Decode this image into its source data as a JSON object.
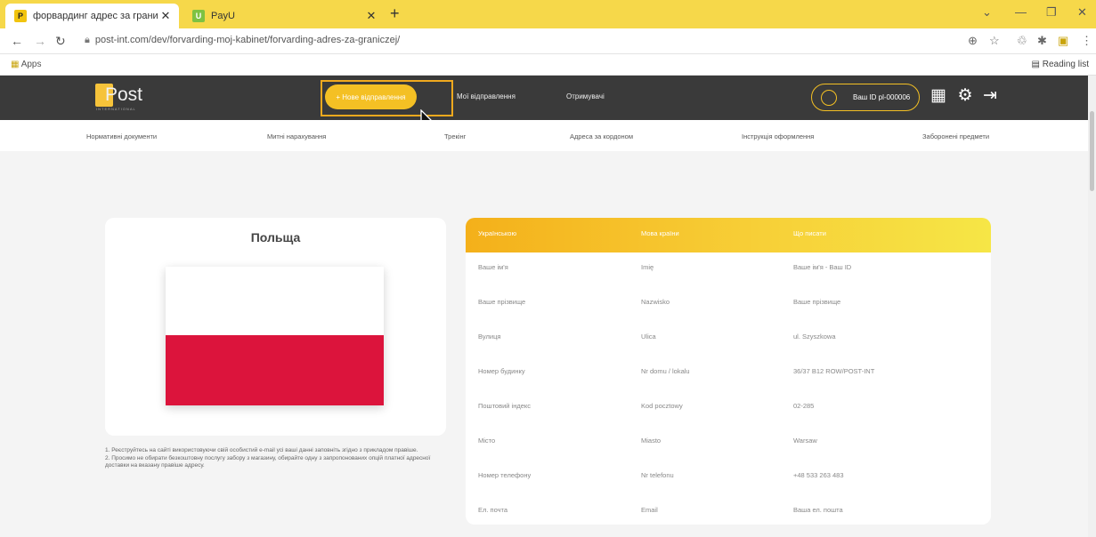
{
  "browser": {
    "tabs": [
      {
        "title": "форвардинг адрес за границей",
        "favicon": "P",
        "active": true
      },
      {
        "title": "PayU",
        "favicon": "U",
        "active": false
      }
    ],
    "url": "post-int.com/dev/forvarding-moj-kabinet/forvarding-adres-za-graniczej/",
    "bookmarks_apps": "Apps",
    "reading_list": "Reading list"
  },
  "site": {
    "logo": {
      "word": "Post",
      "tagline": "INTERNATIONAL"
    },
    "header": {
      "new_shipment": "+ Нове відправлення",
      "my_shipments": "Мої відправлення",
      "recipients": "Отримувачі",
      "account_label": "Ваш ID pl-000006"
    },
    "subnav": [
      "Нормативні документи",
      "Митні нарахування",
      "Трекінг",
      "Адреса за кордоном",
      "Інструкція оформлення",
      "Заборонені предмети"
    ]
  },
  "country": {
    "name": "Польща",
    "flag_colors": {
      "top": "#ffffff",
      "bottom": "#dc143c"
    }
  },
  "notes": [
    "1. Реєструйтесь на сайті використовуючи свій особистий e-mail усі ваші данні заповніть згідно з прикладом правіше.",
    "2. Просимо не обирати безкоштовну послугу забору з магазину, обирайте одну з запропонованих опцій платної адресної доставки на вказану правіше адресу."
  ],
  "address_table": {
    "headers": [
      "Українською",
      "Мова країни",
      "Що писати"
    ],
    "rows": [
      [
        "Ваше ім'я",
        "Imię",
        "Ваше ім'я - Ваш ID"
      ],
      [
        "Ваше прізвище",
        "Nazwisko",
        "Ваше прізвище"
      ],
      [
        "Вулиця",
        "Ulica",
        "ul. Szyszkowa"
      ],
      [
        "Номер будинку",
        "Nr domu / lokalu",
        "36/37 B12 ROW/POST-INT"
      ],
      [
        "Поштовий індекс",
        "Kod pocztowy",
        "02-285"
      ],
      [
        "Місто",
        "Miasto",
        "Warsaw"
      ],
      [
        "Номер телефону",
        "Nr telefonu",
        "+48 533 263 483"
      ],
      [
        "Ел. почта",
        "Email",
        "Ваша ел. пошта"
      ]
    ]
  },
  "colors": {
    "accent": "#f4c024",
    "header_bg": "#3a3a3a",
    "highlight": "#f0a91e"
  }
}
